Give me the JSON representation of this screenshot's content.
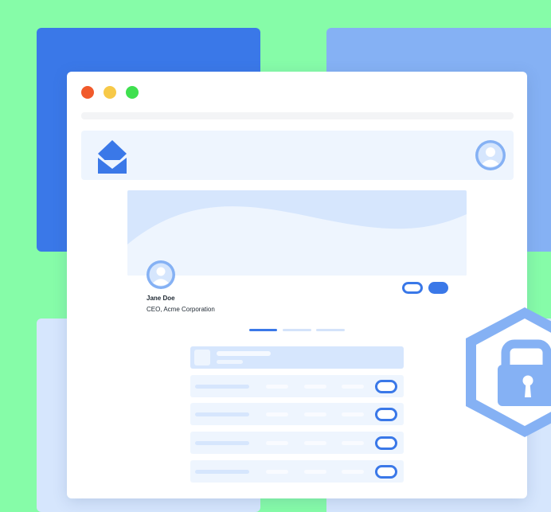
{
  "profile": {
    "name": "Jane Doe",
    "title": "CEO, Acme Corporation"
  },
  "tabs": {
    "active_index": 0,
    "count": 3
  },
  "table": {
    "row_count": 4
  },
  "colors": {
    "background": "#86FCA8",
    "accent": "#3A78E8",
    "accent_light": "#85B1F4",
    "pale": "#D6E6FD",
    "window_close": "#F15A2B",
    "window_minimize": "#F7C948",
    "window_maximize": "#3FE04F"
  },
  "icons": {
    "logo": "diamond-logo-icon",
    "header_avatar": "user-avatar-icon",
    "profile_avatar": "user-avatar-icon",
    "security": "padlock-hexagon-icon"
  }
}
